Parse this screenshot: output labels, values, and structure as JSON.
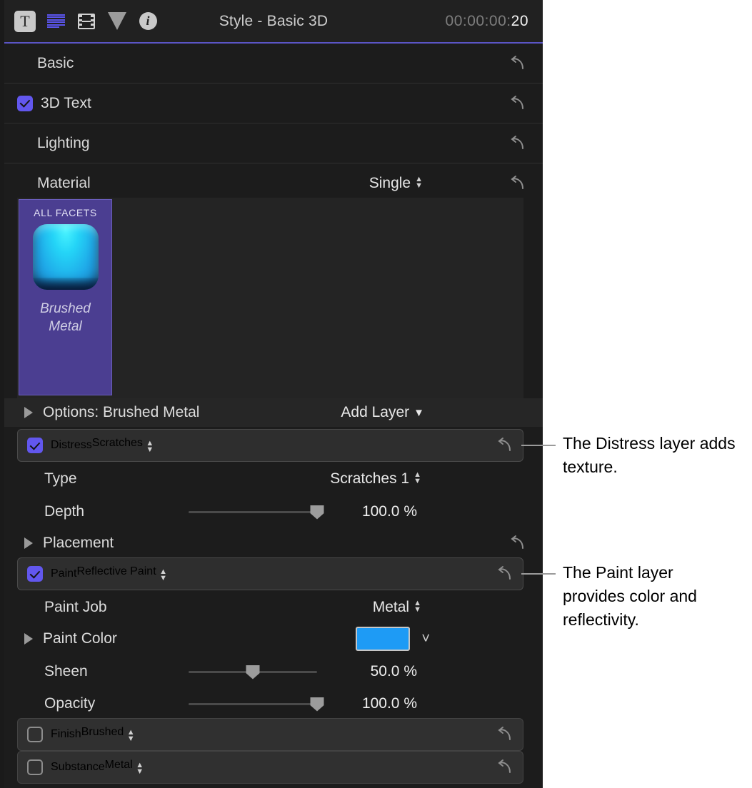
{
  "toolbar": {
    "icons": [
      {
        "name": "text-icon",
        "glyph": "T"
      },
      {
        "name": "paragraph-lines-icon"
      },
      {
        "name": "film-strip-icon"
      },
      {
        "name": "cone-shape-icon"
      },
      {
        "name": "info-icon",
        "glyph": "i"
      }
    ],
    "title": "Style - Basic 3D",
    "timecode_base": "00:00:00:",
    "timecode_frames": "20"
  },
  "sections": {
    "basic": {
      "label": "Basic",
      "reset": "reset-icon"
    },
    "three_d_text": {
      "label": "3D Text",
      "checked": true
    },
    "lighting": {
      "label": "Lighting"
    },
    "material": {
      "label": "Material",
      "value": "Single"
    }
  },
  "material_preview": {
    "facet_label": "ALL FACETS",
    "material_name_line1": "Brushed",
    "material_name_line2": "Metal",
    "card_color": "#4b3e91",
    "swatch_color": "#24d4f7"
  },
  "options": {
    "label": "Options: Brushed Metal",
    "add_layer_label": "Add Layer"
  },
  "layers": {
    "distress": {
      "label": "Distress",
      "value": "Scratches",
      "checked": true,
      "rows": [
        {
          "label": "Type",
          "value": "Scratches 1",
          "kind": "popup"
        },
        {
          "label": "Depth",
          "value": "100.0 %",
          "kind": "slider",
          "percent": 100
        },
        {
          "label": "Placement",
          "kind": "disclosure"
        }
      ]
    },
    "paint": {
      "label": "Paint",
      "value": "Reflective Paint",
      "checked": true,
      "rows": [
        {
          "label": "Paint Job",
          "value": "Metal",
          "kind": "popup"
        },
        {
          "label": "Paint Color",
          "value": "#1e9bf5",
          "kind": "color"
        },
        {
          "label": "Sheen",
          "value": "50.0 %",
          "kind": "slider",
          "percent": 50
        },
        {
          "label": "Opacity",
          "value": "100.0 %",
          "kind": "slider",
          "percent": 100
        }
      ]
    },
    "finish": {
      "label": "Finish",
      "value": "Brushed",
      "checked": false
    },
    "substance": {
      "label": "Substance",
      "value": "Metal",
      "checked": false
    }
  },
  "callouts": [
    {
      "text": "The Distress layer adds texture."
    },
    {
      "text": "The Paint layer provides color and reflectivity."
    }
  ],
  "colors": {
    "accent_purple": "#5b55c6",
    "checkbox_on": "#6257ee",
    "paint_color": "#1e9bf5",
    "panel_bg": "#1c1c1c"
  }
}
